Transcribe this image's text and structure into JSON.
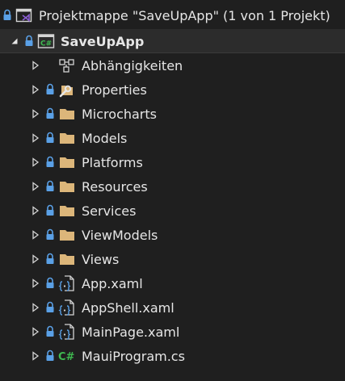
{
  "solution": {
    "label": "Projektmappe \"SaveUpApp\" (1 von 1 Projekt)",
    "icon": "solution-icon"
  },
  "project": {
    "label": "SaveUpApp",
    "icon": "csharp-project-icon"
  },
  "items": [
    {
      "label": "Abhängigkeiten",
      "icon": "dependencies-icon"
    },
    {
      "label": "Properties",
      "icon": "properties-wrench-icon"
    },
    {
      "label": "Microcharts",
      "icon": "folder-icon"
    },
    {
      "label": "Models",
      "icon": "folder-icon"
    },
    {
      "label": "Platforms",
      "icon": "folder-icon"
    },
    {
      "label": "Resources",
      "icon": "folder-icon"
    },
    {
      "label": "Services",
      "icon": "folder-icon"
    },
    {
      "label": "ViewModels",
      "icon": "folder-icon"
    },
    {
      "label": "Views",
      "icon": "folder-icon"
    },
    {
      "label": "App.xaml",
      "icon": "xaml-file-icon"
    },
    {
      "label": "AppShell.xaml",
      "icon": "xaml-file-icon"
    },
    {
      "label": "MainPage.xaml",
      "icon": "xaml-file-icon"
    },
    {
      "label": "MauiProgram.cs",
      "icon": "csharp-file-icon"
    }
  ],
  "colors": {
    "background": "#1f1f1f",
    "selected_row": "#2c2c2c",
    "text": "#e6e6e6",
    "lock": "#5aa0e6",
    "folder": "#dcb67a",
    "csharp": "#3fb950",
    "solution_purple": "#8c5fd6"
  }
}
